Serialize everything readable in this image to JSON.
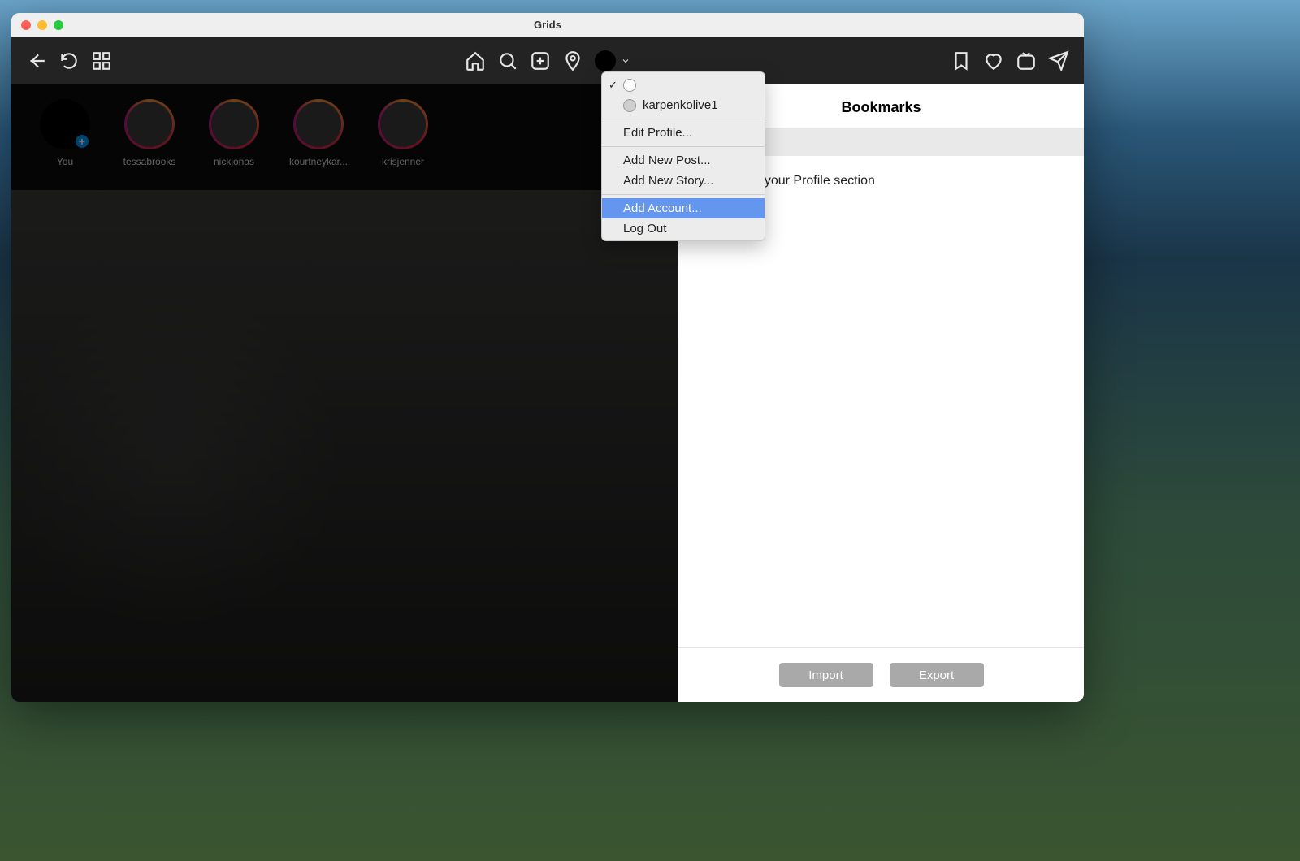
{
  "window": {
    "title": "Grids"
  },
  "toolbar": {
    "icons_left": [
      "back",
      "reload",
      "grid"
    ],
    "icons_center": [
      "home",
      "search",
      "new-post",
      "location"
    ],
    "icons_right": [
      "bookmark",
      "heart",
      "igtv",
      "direct"
    ]
  },
  "stories": [
    {
      "label": "You",
      "you": true
    },
    {
      "label": "tessabrooks"
    },
    {
      "label": "nickjonas"
    },
    {
      "label": "kourtneykar..."
    },
    {
      "label": "krisjenner"
    }
  ],
  "panel": {
    "title": "Bookmarks",
    "body_text_fragment": "ed posts in your Profile section",
    "import_label": "Import",
    "export_label": "Export"
  },
  "menu": {
    "accounts": [
      {
        "name": "",
        "checked": true
      },
      {
        "name": "karpenkolive1",
        "checked": false
      }
    ],
    "edit_profile": "Edit Profile...",
    "add_post": "Add New Post...",
    "add_story": "Add New Story...",
    "add_account": "Add Account...",
    "log_out": "Log Out",
    "highlighted": "add_account"
  }
}
